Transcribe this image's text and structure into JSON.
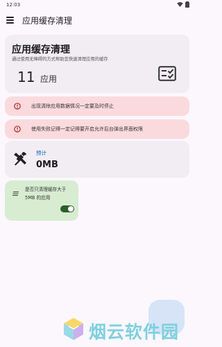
{
  "status_bar": {
    "time": "12:03"
  },
  "app_bar": {
    "title": "应用缓存清理"
  },
  "main_card": {
    "title": "应用缓存清理",
    "subtitle": "通过使用无障碍的方式帮助您快速清理应用的缓存",
    "count": "11",
    "count_unit": "应用"
  },
  "warnings": [
    {
      "text": "出现清除应用数据情况一定要及时停止"
    },
    {
      "text": "使用失败记得一定记得要开启允许后台弹出界面权限"
    }
  ],
  "estimate_card": {
    "label": "预计",
    "value": "0MB"
  },
  "option_card": {
    "text": "是否只清理缓存大于5MB 的应用",
    "toggle_on": true
  },
  "watermark": {
    "text": "烟云软件园"
  },
  "colors": {
    "background": "#fbf7fd",
    "card": "#f1edf2",
    "warning_card": "#fadadd",
    "warning_icon": "#b3261e",
    "option_card": "#d7ecd0",
    "accent_blue": "#1565c0",
    "toggle_on": "#2e5e2a",
    "fab": "#d7e4f7"
  },
  "icons": {
    "menu": "menu-icon",
    "main_card": "checklist-icon",
    "warning": "alert-circle-icon",
    "estimate": "tools-icon",
    "option": "layers-icon"
  }
}
